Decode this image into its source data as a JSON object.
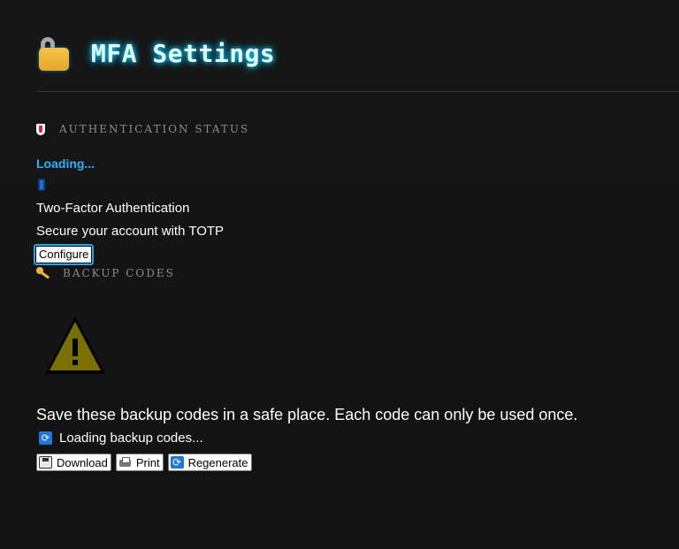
{
  "header": {
    "title": "MFA Settings",
    "icon": "lock-icon"
  },
  "auth_status": {
    "heading": "AUTHENTICATION STATUS",
    "icon": "shield-icon",
    "status_text": "Loading...",
    "method_icon": "phone-icon",
    "method_title": "Two-Factor Authentication",
    "method_description": "Secure your account with TOTP",
    "configure_label": "Configure"
  },
  "backup_codes": {
    "heading": "BACKUP CODES",
    "icon": "key-icon",
    "warning_icon": "warning-icon",
    "info_text": "Save these backup codes in a safe place. Each code can only be used once.",
    "loading_text": "Loading backup codes...",
    "loading_icon": "refresh-icon",
    "actions": {
      "download": "Download",
      "print": "Print",
      "regenerate": "Regenerate"
    }
  },
  "colors": {
    "background": "#141414",
    "title_glow": "#00d4ff",
    "status_blue": "#2fb1ff",
    "warning_fill": "#7a7000",
    "lock_gold": "#f0b43a"
  }
}
